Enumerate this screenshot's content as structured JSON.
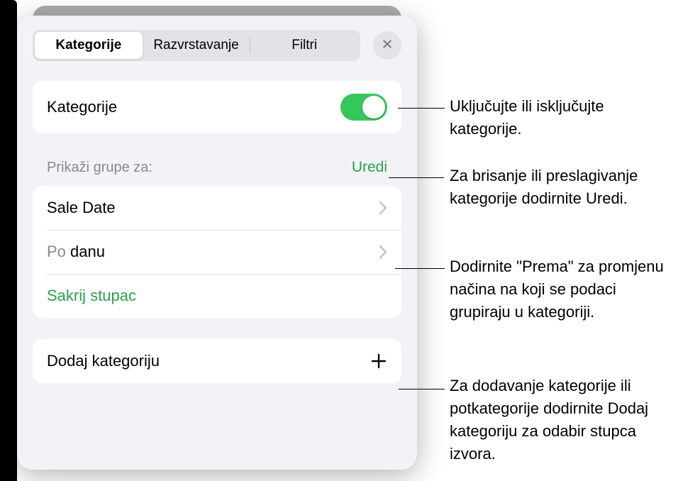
{
  "tabs": {
    "categories": "Kategorije",
    "sorting": "Razvrstavanje",
    "filters": "Filtri"
  },
  "toggleRow": {
    "label": "Kategorije"
  },
  "groupsSection": {
    "header": "Prikaži grupe za:",
    "edit": "Uredi",
    "items": {
      "saleDate": "Sale Date",
      "byPrefix": "Po ",
      "byValue": "danu",
      "hideColumn": "Sakrij stupac"
    }
  },
  "addCategory": {
    "label": "Dodaj kategoriju"
  },
  "callouts": {
    "toggle": "Uključujte ili isključujte kategorije.",
    "edit": "Za brisanje ili preslagivanje kategorije dodirnite Uredi.",
    "by": "Dodirnite \"Prema\" za promjenu načina na koji se podaci grupiraju u kategoriji.",
    "add": "Za dodavanje kategorije ili potkategorije dodirnite Dodaj kategoriju za odabir stupca izvora."
  }
}
